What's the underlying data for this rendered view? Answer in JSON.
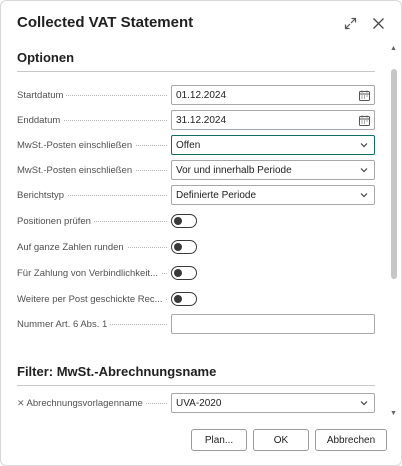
{
  "dialog": {
    "title": "Collected VAT Statement",
    "expand_icon": "expand-icon",
    "close_icon": "close-icon"
  },
  "options": {
    "heading": "Optionen",
    "fields": [
      {
        "label": "Startdatum",
        "value": "01.12.2024",
        "type": "date"
      },
      {
        "label": "Enddatum",
        "value": "31.12.2024",
        "type": "date"
      },
      {
        "label": "MwSt.-Posten einschließen",
        "value": "Offen",
        "type": "select"
      },
      {
        "label": "MwSt.-Posten einschließen",
        "value": "Vor und innerhalb Periode",
        "type": "select"
      },
      {
        "label": "Berichtstyp",
        "value": "Definierte Periode",
        "type": "select"
      }
    ],
    "toggles": [
      {
        "label": "Positionen prüfen",
        "on": false
      },
      {
        "label": "Auf ganze Zahlen runden",
        "on": false
      },
      {
        "label": "Für Zahlung von Verbindlichkeit...",
        "on": false
      },
      {
        "label": "Weitere per Post geschickte Rec...",
        "on": false
      }
    ],
    "text_field": {
      "label": "Nummer Art. 6 Abs. 1",
      "value": ""
    }
  },
  "filter": {
    "heading": "Filter: MwSt.-Abrechnungsname",
    "field": {
      "label": "Abrechnungsvorlagenname",
      "value": "UVA-2020"
    }
  },
  "buttons": {
    "plan": "Plan...",
    "ok": "OK",
    "cancel": "Abbrechen"
  },
  "colors": {
    "accent": "#0f6f66",
    "border": "#a8a8a8"
  }
}
